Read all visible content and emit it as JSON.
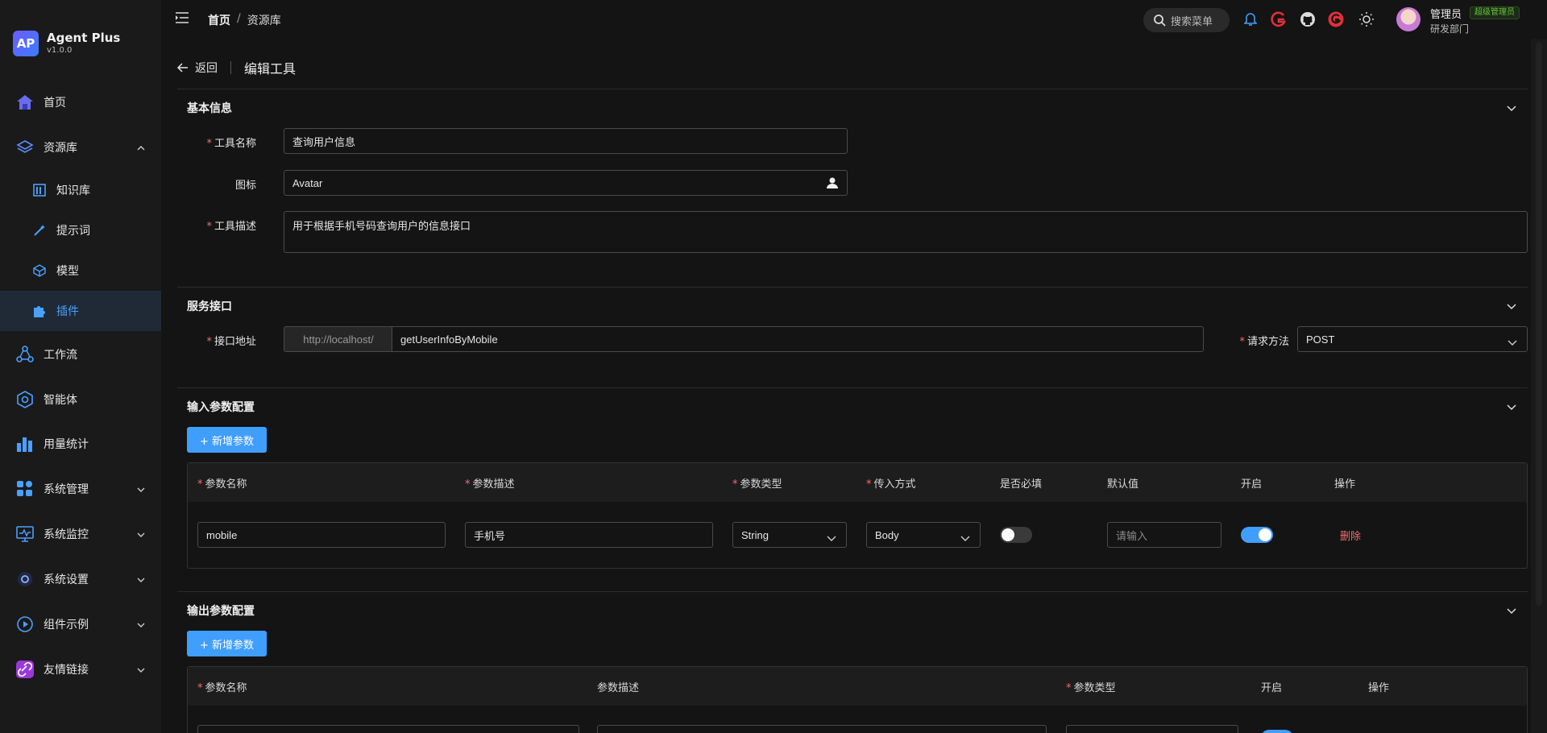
{
  "brand": {
    "name": "Agent Plus",
    "version": "v1.0.0",
    "logo_text": "AP"
  },
  "sidebar": {
    "items": [
      {
        "label": "首页",
        "icon": "home-icon"
      },
      {
        "label": "资源库",
        "icon": "layers-icon",
        "expanded": true
      },
      {
        "label": "工作流",
        "icon": "workflow-icon"
      },
      {
        "label": "智能体",
        "icon": "agent-icon"
      },
      {
        "label": "用量统计",
        "icon": "bar-chart-icon"
      },
      {
        "label": "系统管理",
        "icon": "grid-icon"
      },
      {
        "label": "系统监控",
        "icon": "monitor-icon"
      },
      {
        "label": "系统设置",
        "icon": "settings-icon"
      },
      {
        "label": "组件示例",
        "icon": "play-icon"
      },
      {
        "label": "友情链接",
        "icon": "link-icon"
      }
    ],
    "sub_items": [
      {
        "label": "知识库",
        "icon": "book-icon"
      },
      {
        "label": "提示词",
        "icon": "wand-icon"
      },
      {
        "label": "模型",
        "icon": "cube-icon"
      },
      {
        "label": "插件",
        "icon": "puzzle-icon",
        "active": true
      }
    ]
  },
  "header": {
    "breadcrumb": [
      "首页",
      "资源库"
    ],
    "search_placeholder": "搜索菜单",
    "user": {
      "name": "管理员",
      "role_badge": "超级管理员",
      "dept": "研发部门"
    }
  },
  "page": {
    "back_label": "返回",
    "title": "编辑工具"
  },
  "basic": {
    "title": "基本信息",
    "name_label": "工具名称",
    "name_value": "查询用户信息",
    "icon_label": "图标",
    "icon_value": "Avatar",
    "desc_label": "工具描述",
    "desc_value": "用于根据手机号码查询用户的信息接口"
  },
  "service": {
    "title": "服务接口",
    "url_label": "接口地址",
    "url_prefix": "http://localhost/",
    "url_value": "getUserInfoByMobile",
    "method_label": "请求方法",
    "method_value": "POST"
  },
  "input_params": {
    "title": "输入参数配置",
    "add_label": "+ 新增参数",
    "headers": [
      "参数名称",
      "参数描述",
      "参数类型",
      "传入方式",
      "是否必填",
      "默认值",
      "开启",
      "操作"
    ],
    "rows": [
      {
        "name": "mobile",
        "desc": "手机号",
        "type": "String",
        "method": "Body",
        "required": false,
        "default_placeholder": "请输入",
        "enabled": true,
        "action": "删除"
      }
    ]
  },
  "output_params": {
    "title": "输出参数配置",
    "add_label": "+ 新增参数",
    "headers": [
      "参数名称",
      "参数描述",
      "参数类型",
      "开启",
      "操作"
    ]
  },
  "colors": {
    "primary": "#409eff",
    "danger": "#f56c6c",
    "active_bg": "#1f2a36"
  }
}
